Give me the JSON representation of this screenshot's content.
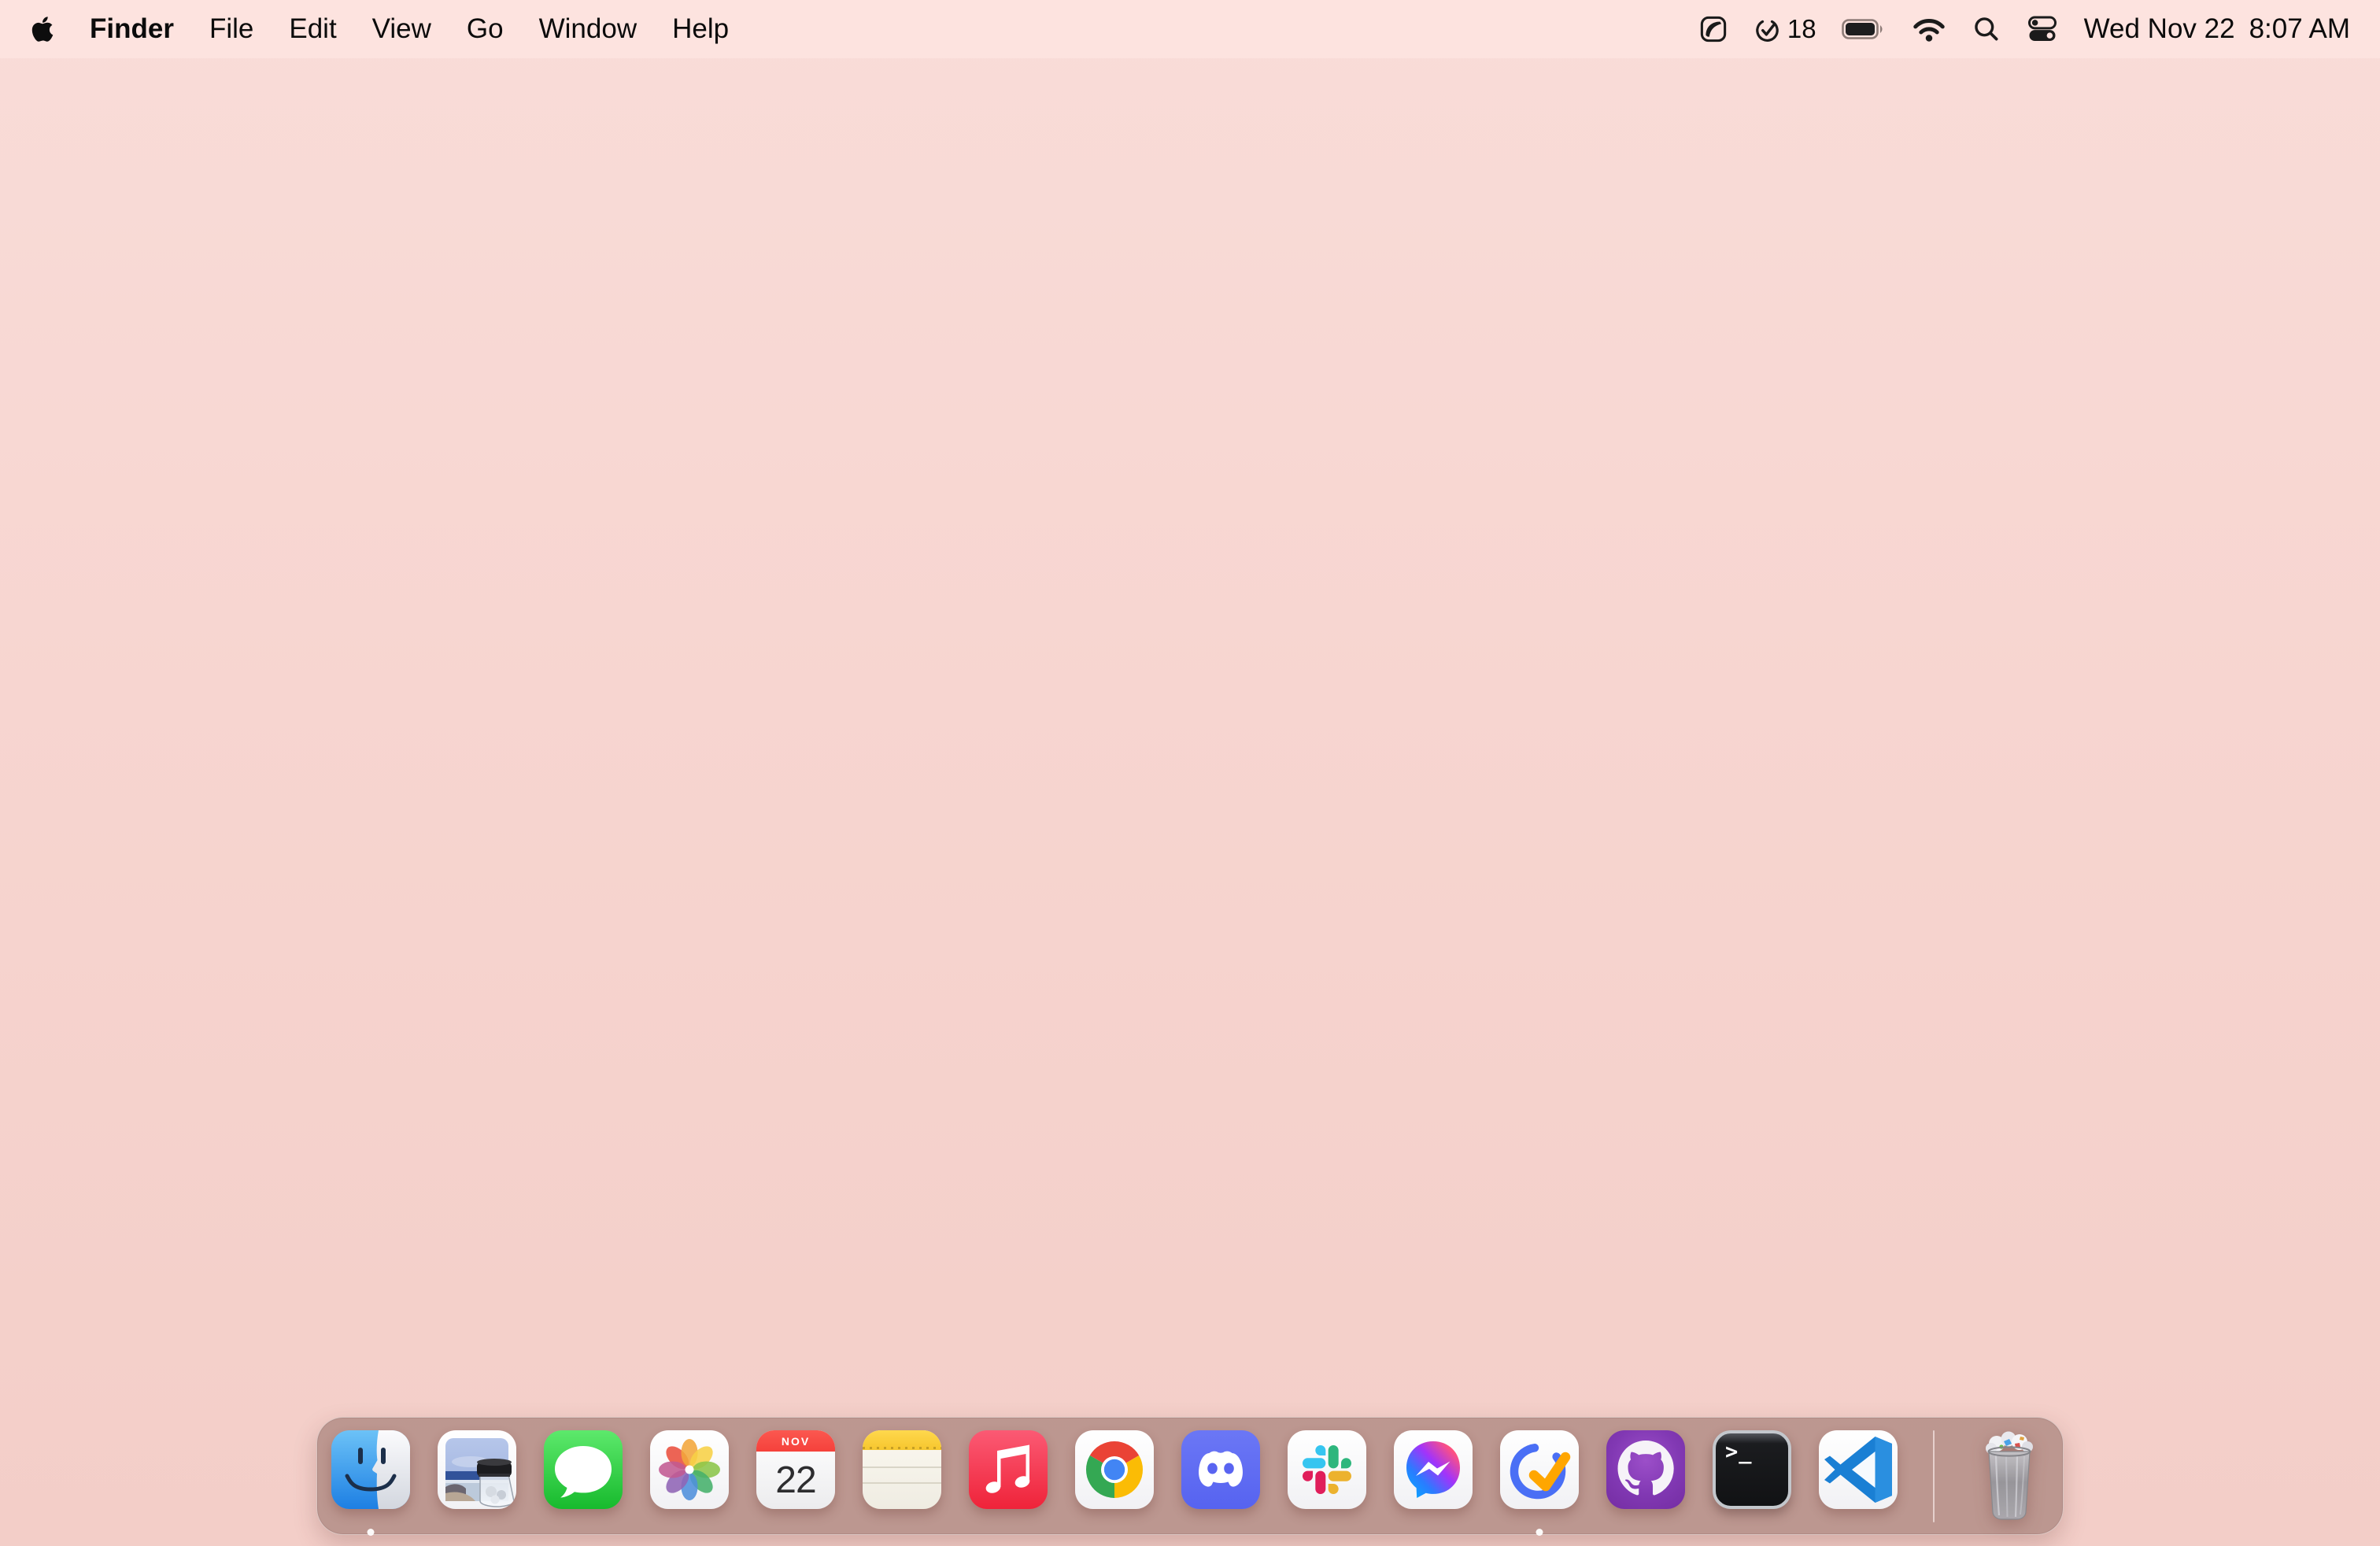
{
  "wallpaper": {
    "top_color": "#f9dcd8",
    "bottom_color": "#f3cec8",
    "style": "plain pink"
  },
  "menu_bar": {
    "apple_logo_icon": "apple-icon",
    "active_app": "Finder",
    "menus": [
      "Finder",
      "File",
      "Edit",
      "View",
      "Go",
      "Window",
      "Help"
    ],
    "status": {
      "extra_icon": "folded-shape-menu-extra-icon",
      "task_icon": "check-circle-icon",
      "task_badge_count": "18",
      "battery_icon": "battery-full-icon",
      "wifi_icon": "wifi-icon",
      "spotlight_icon": "search-icon",
      "control_center_icon": "control-center-icon",
      "date": "Wed Nov 22",
      "time": "8:07 AM"
    }
  },
  "dock": {
    "calendar_month": "NOV",
    "calendar_day": "22",
    "terminal_glyph": ">_",
    "items": [
      {
        "name": "Finder",
        "running": true
      },
      {
        "name": "Preview",
        "running": false
      },
      {
        "name": "Messages",
        "running": false
      },
      {
        "name": "Photos",
        "running": false
      },
      {
        "name": "Calendar",
        "running": false
      },
      {
        "name": "Notes",
        "running": false
      },
      {
        "name": "Music",
        "running": false
      },
      {
        "name": "Google Chrome",
        "running": false
      },
      {
        "name": "Discord",
        "running": false
      },
      {
        "name": "Slack",
        "running": false
      },
      {
        "name": "Messenger",
        "running": false
      },
      {
        "name": "TickTick",
        "running": true
      },
      {
        "name": "GitHub Desktop",
        "running": false
      },
      {
        "name": "Terminal",
        "running": false
      },
      {
        "name": "Visual Studio Code",
        "running": false
      },
      {
        "name": "Trash",
        "running": false,
        "state": "full"
      }
    ]
  }
}
